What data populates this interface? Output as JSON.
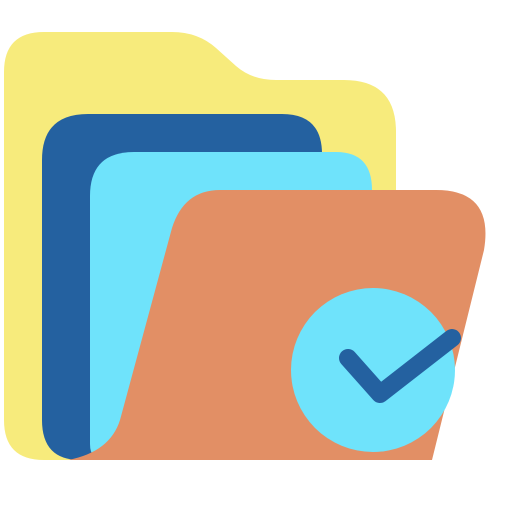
{
  "icon": {
    "name": "folder-check-icon",
    "colors": {
      "back_folder": "#F7EB7C",
      "dark_sheet": "#2461A0",
      "light_sheet": "#6FE3FB",
      "front_folder": "#E28F65",
      "check_badge": "#6FE3FB",
      "check_mark": "#2461A0"
    }
  }
}
